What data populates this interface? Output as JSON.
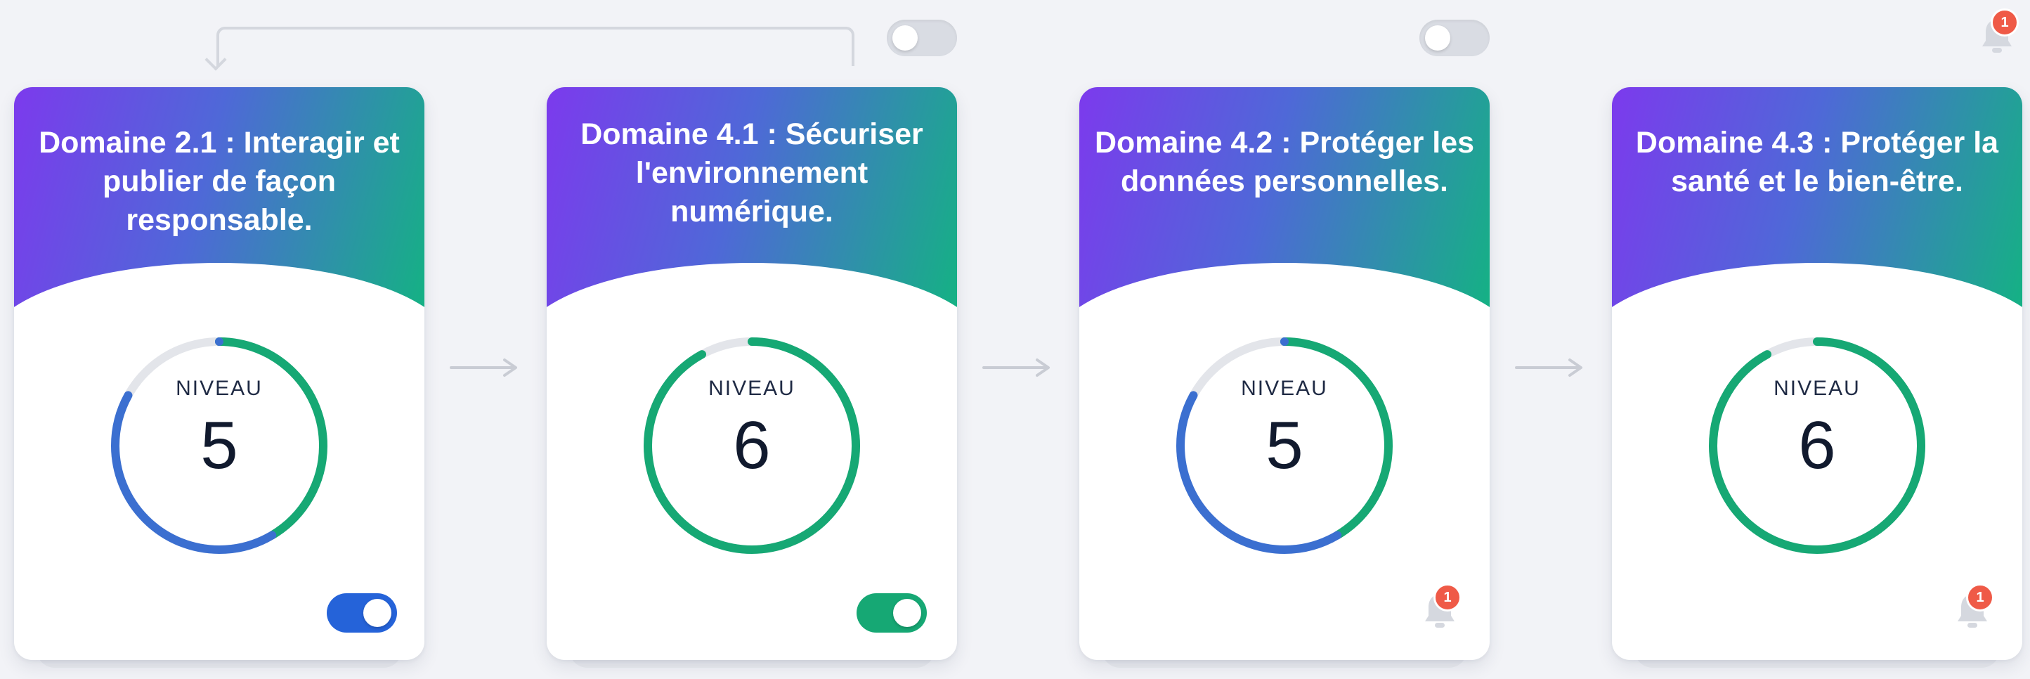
{
  "colors": {
    "progress_green": "#16a874",
    "progress_blue": "#3b6fd0",
    "track": "#e3e5ea",
    "toggle_blue": "#2563d9",
    "toggle_green": "#16a874",
    "badge_red": "#ef5a47"
  },
  "top_bar": {
    "bell_badge": "1"
  },
  "cards": [
    {
      "title": "Domaine 2.1 : Interagir et publier de façon responsable.",
      "level_label": "NIVEAU",
      "level": "5",
      "progress_fraction": 0.83,
      "toggle": "on-blue"
    },
    {
      "title": "Domaine 4.1 : Sécuriser l'environnement numérique.",
      "level_label": "NIVEAU",
      "level": "6",
      "progress_fraction": 0.92,
      "toggle": "on-green"
    },
    {
      "title": "Domaine 4.2 : Protéger les données personnelles.",
      "level_label": "NIVEAU",
      "level": "5",
      "progress_fraction": 0.83,
      "bell_badge": "1"
    },
    {
      "title": "Domaine 4.3 : Protéger la santé et le bien-être.",
      "level_label": "NIVEAU",
      "level": "6",
      "progress_fraction": 0.92,
      "bell_badge": "1"
    }
  ]
}
